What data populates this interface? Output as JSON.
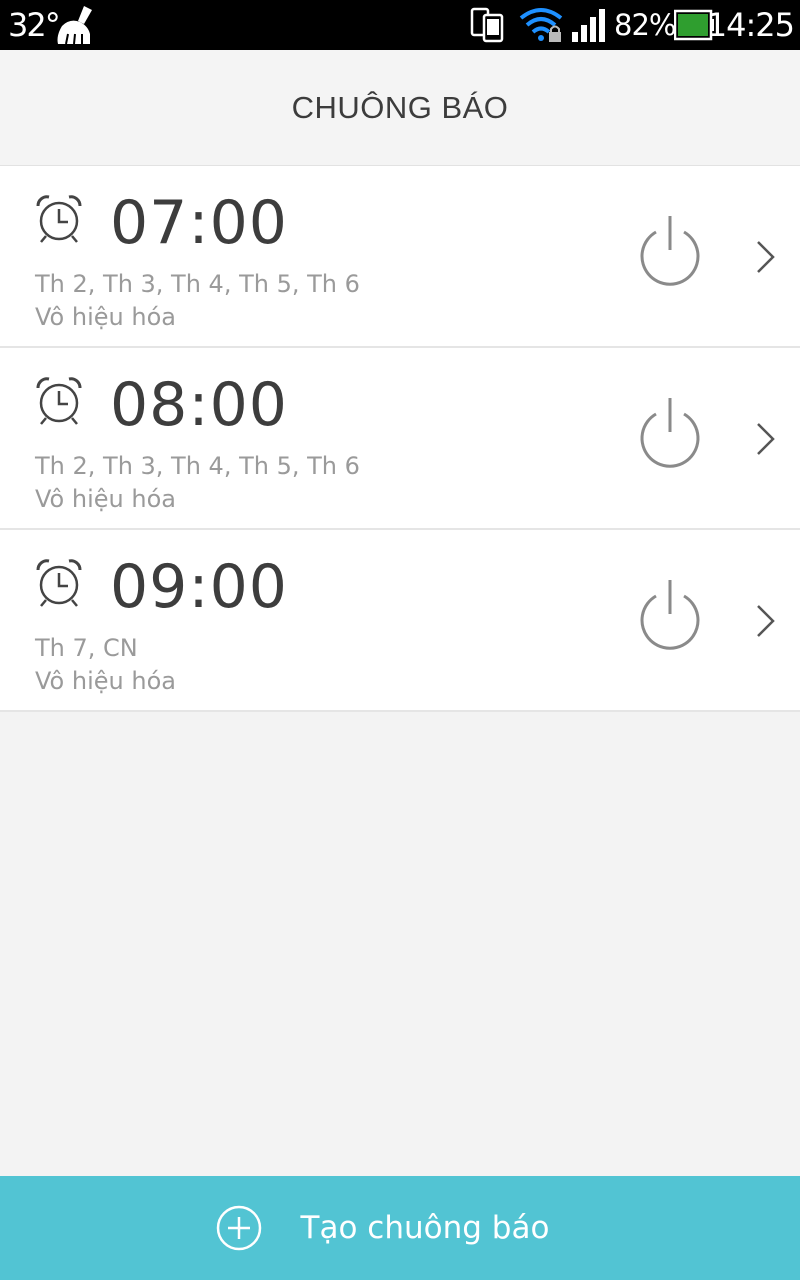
{
  "status_bar": {
    "temperature": "32°",
    "battery_percent": "82%",
    "time": "14:25"
  },
  "header": {
    "title": "CHUÔNG BÁO"
  },
  "alarms": [
    {
      "time": "07:00",
      "days": "Th 2, Th 3, Th 4, Th 5, Th 6",
      "status": "Vô hiệu hóa"
    },
    {
      "time": "08:00",
      "days": "Th 2, Th 3, Th 4, Th 5, Th 6",
      "status": "Vô hiệu hóa"
    },
    {
      "time": "09:00",
      "days": "Th 7, CN",
      "status": "Vô hiệu hóa"
    }
  ],
  "add_button": {
    "label": "Tạo chuông báo",
    "icon": "plus-circle-icon"
  },
  "colors": {
    "accent": "#52c4d3",
    "background": "#f3f3f3",
    "status_bar": "#000000",
    "text_primary": "#3d3d3d",
    "text_secondary": "#9a9a9a"
  }
}
